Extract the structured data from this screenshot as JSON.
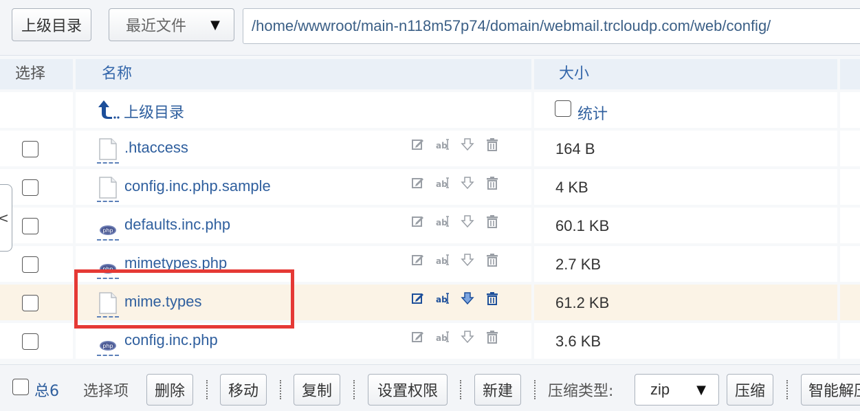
{
  "toolbar": {
    "up_label": "上级目录",
    "recent_label": "最近文件",
    "recent_arrow": "▼",
    "path": "/home/wwwroot/main-n118m57p74/domain/webmail.trcloudp.com/web/config/"
  },
  "table": {
    "headers": {
      "select": "选择",
      "name": "名称",
      "size": "大小"
    },
    "parent_row": {
      "label": "上级目录",
      "stat_label": "统计"
    },
    "rows": [
      {
        "name": ".htaccess",
        "size": "164 B",
        "icon": "file-icon"
      },
      {
        "name": "config.inc.php.sample",
        "size": "4 KB",
        "icon": "file-icon"
      },
      {
        "name": "defaults.inc.php",
        "size": "60.1 KB",
        "icon": "php-icon"
      },
      {
        "name": "mimetypes.php",
        "size": "2.7 KB",
        "icon": "php-icon"
      },
      {
        "name": "mime.types",
        "size": "61.2 KB",
        "icon": "file-icon"
      },
      {
        "name": "config.inc.php",
        "size": "3.6 KB",
        "icon": "php-icon"
      }
    ],
    "highlighted_row": 4
  },
  "footer": {
    "total": "总6",
    "selected_label": "选择项",
    "delete": "删除",
    "move": "移动",
    "copy": "复制",
    "permissions": "设置权限",
    "new": "新建",
    "compress_type_label": "压缩类型:",
    "compress_type_value": "zip",
    "compress_arrow": "▼",
    "compress": "压缩",
    "smart_extract": "智能解压"
  },
  "side_tab": {
    "label": "<"
  },
  "colors": {
    "link": "#2f5f9e",
    "highlight": "#fbf3e6",
    "annotation_box": "#e53935"
  }
}
